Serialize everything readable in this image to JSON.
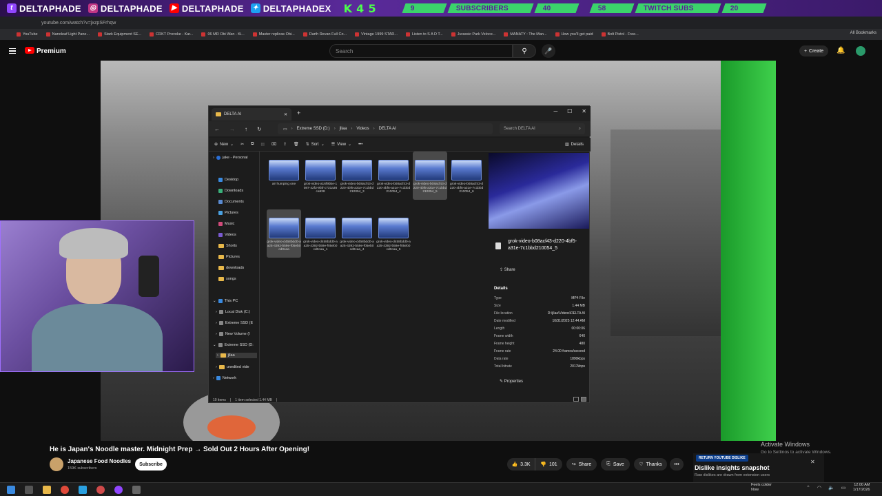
{
  "banner": {
    "handles": [
      "DELTAPHADE",
      "DELTAPHADE",
      "DELTAPHADE",
      "DELTAPHADE",
      "DELTAPHADEX"
    ],
    "goal_text": "K 4 5",
    "stats": [
      {
        "value": "9",
        "label": "SUBSCRIBERS",
        "goal": "40"
      },
      {
        "value": "58",
        "label": "TWITCH SUBS",
        "goal": "20"
      }
    ]
  },
  "browser": {
    "url": "youtube.com/watch?v=jxzpSFrhqw",
    "bookmarks": [
      "YouTube",
      "Nanoleaf Light Pane...",
      "Stark Equipment SE...",
      "CRKT Provoke - Kar...",
      "06 MR Obi Wan - Ki...",
      "Master replicas Obi...",
      "Darth Revan Full Co...",
      "Vintage 1999 STAR...",
      "Listen to S A D T...",
      "Jurassic Park Veloce...",
      "MANATY : The Man...",
      "How you'll get paid",
      "Bolt Pistol - Free..."
    ],
    "all_bookmarks": "All Bookmarks"
  },
  "youtube": {
    "brand": "Premium",
    "search_placeholder": "Search",
    "create": "Create",
    "video_title": "He is Japan's Noodle master. Midnight Prep → Sold Out 2 Hours After Opening!",
    "channel": "Japanese Food Noodles",
    "subscribers": "159K subscribers",
    "subscribe": "Subscribe",
    "likes": "3.3K",
    "dislikes": "101",
    "share": "Share",
    "save": "Save",
    "thanks": "Thanks",
    "more": "•••"
  },
  "explorer": {
    "tab_title": "DELTA AI",
    "breadcrumbs": [
      "Extreme SSD (D:)",
      "jllaa",
      "Videos",
      "DELTA AI"
    ],
    "search_placeholder": "Search DELTA AI",
    "commands": {
      "new": "New",
      "sort": "Sort",
      "view": "View",
      "details": "Details"
    },
    "nav": {
      "personal": "jake - Personal",
      "quick": [
        "Desktop",
        "Downloads",
        "Documents",
        "Pictures",
        "Music",
        "Videos",
        "Shorts",
        "Pictures",
        "downloads",
        "songs"
      ],
      "this_pc": "This PC",
      "drives": [
        "Local Disk (C:)",
        "Extreme SSD (E",
        "New Volume (I",
        "Extreme SSD (D:"
      ],
      "sub": [
        "jllaa",
        "unedited vide"
      ],
      "network": "Network"
    },
    "files": [
      {
        "name": "air humping one"
      },
      {
        "name": "grok-video-a16f9bbe-1087-42f3-9faf-c731a36ca938"
      },
      {
        "name": "grok-video-b08acf43-d220-4bf5-a31e-7c1bbd210054_3"
      },
      {
        "name": "grok-video-b08acf43-d220-4bf5-a31e-7c1bbd210054_4"
      },
      {
        "name": "grok-video-b08acf43-d220-4bf5-a31e-7c1bbd210054_5"
      },
      {
        "name": "grok-video-b08acf43-d220-4bf5-a31e-7c1bbd210054_6"
      },
      {
        "name": "grok-video-d458bdd0-aa25-4392-b59e-f05eb0cd0caa"
      },
      {
        "name": "grok-video-d458bdd0-aa25-4392-b59e-f05eb0cd0caa_1"
      },
      {
        "name": "grok-video-d458bdd0-aa25-4392-b59e-f05eb0cd0caa_4"
      },
      {
        "name": "grok-video-d458bdd0-aa25-4392-b59e-f05eb0cd0caa_6"
      }
    ],
    "detail": {
      "name": "grok-video-b08acf43-d220-4bf5-a31e-7c1bbd210054_5",
      "share": "Share",
      "heading": "Details",
      "rows": [
        {
          "k": "Type",
          "v": "MP4 File"
        },
        {
          "k": "Size",
          "v": "1.44 MB"
        },
        {
          "k": "File location",
          "v": "D:\\jllaa\\Videos\\DELTA AI"
        },
        {
          "k": "Date modified",
          "v": "10/31/2025 12:44 AM"
        },
        {
          "k": "Length",
          "v": "00:00:06"
        },
        {
          "k": "Frame width",
          "v": "640"
        },
        {
          "k": "Frame height",
          "v": "480"
        },
        {
          "k": "Frame rate",
          "v": "24.00 frames/second"
        },
        {
          "k": "Data rate",
          "v": "1890kbps"
        },
        {
          "k": "Total bitrate",
          "v": "2017kbps"
        }
      ],
      "properties": "Properties"
    },
    "status": {
      "count": "10 items",
      "selected": "1 item selected  1.44 MB"
    }
  },
  "extension": {
    "tag": "RETURN YOUTUBE DISLIKE",
    "title": "Dislike insights snapshot",
    "sub": "Raw dislikes are drawn from extension users"
  },
  "windows_notice": {
    "title": "Activate Windows",
    "sub": "Go to Settings to activate Windows."
  },
  "taskbar": {
    "weather_title": "Feels colder",
    "weather_sub": "Now",
    "time": "12:00 AM",
    "date": "1/17/2026"
  }
}
